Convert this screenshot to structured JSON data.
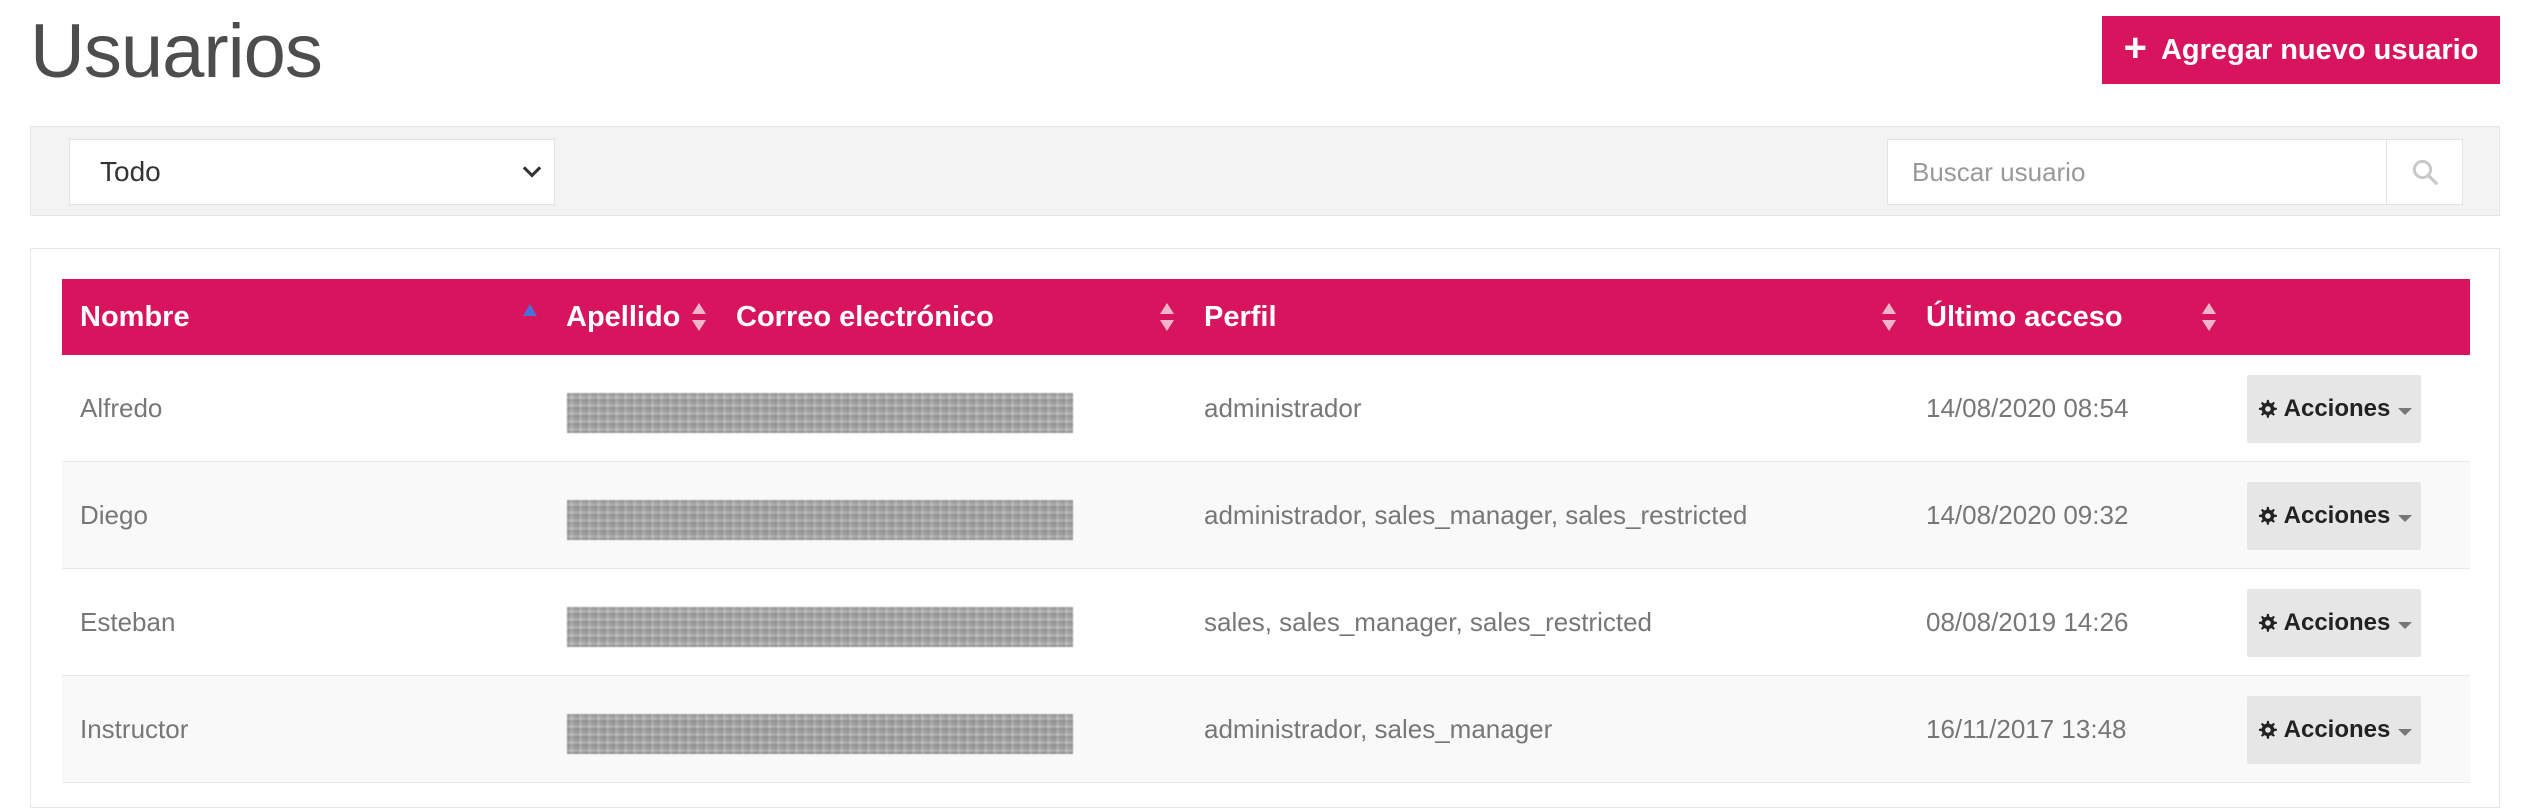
{
  "page": {
    "title": "Usuarios"
  },
  "header": {
    "add_button_label": "Agregar nuevo usuario"
  },
  "filter": {
    "selected": "Todo",
    "search_placeholder": "Buscar usuario"
  },
  "colors": {
    "accent": "#d9145f",
    "sort_active": "#4a6fd6"
  },
  "table": {
    "columns": {
      "nombre": "Nombre",
      "apellido": "Apellido",
      "correo": "Correo electrónico",
      "perfil": "Perfil",
      "ultimo_acceso": "Último acceso"
    },
    "action_label": "Acciones",
    "rows": [
      {
        "nombre": "Alfredo",
        "perfil": "administrador",
        "ultimo_acceso": "14/08/2020 08:54"
      },
      {
        "nombre": "Diego",
        "perfil": "administrador, sales_manager, sales_restricted",
        "ultimo_acceso": "14/08/2020 09:32"
      },
      {
        "nombre": "Esteban",
        "perfil": "sales, sales_manager, sales_restricted",
        "ultimo_acceso": "08/08/2019 14:26"
      },
      {
        "nombre": "Instructor",
        "perfil": "administrador, sales_manager",
        "ultimo_acceso": "16/11/2017 13:48"
      }
    ]
  },
  "icons": {
    "add": "plus-icon",
    "search": "search-icon",
    "actions": "gear-icon",
    "select": "chevron-down-icon"
  }
}
